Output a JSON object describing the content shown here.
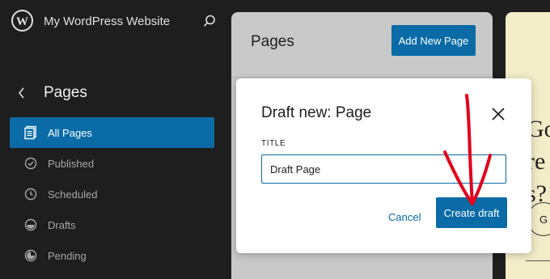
{
  "sidebar": {
    "site_title": "My WordPress Website",
    "section_title": "Pages",
    "items": [
      {
        "label": "All Pages",
        "icon": "pages-icon",
        "active": true
      },
      {
        "label": "Published",
        "icon": "published-icon"
      },
      {
        "label": "Scheduled",
        "icon": "scheduled-icon"
      },
      {
        "label": "Drafts",
        "icon": "drafts-icon"
      },
      {
        "label": "Pending",
        "icon": "pending-icon"
      }
    ]
  },
  "pages_panel": {
    "title": "Pages",
    "add_new_label": "Add New Page"
  },
  "preview": {
    "text": "Go\nre\ns?",
    "button_text": "G"
  },
  "modal": {
    "title": "Draft new: Page",
    "field_label": "TITLE",
    "title_value": "Draft Page",
    "cancel_label": "Cancel",
    "create_label": "Create draft"
  },
  "colors": {
    "accent": "#0a6ba6",
    "sidebar_bg": "#1e1e1e",
    "annotation": "#e3001b"
  }
}
